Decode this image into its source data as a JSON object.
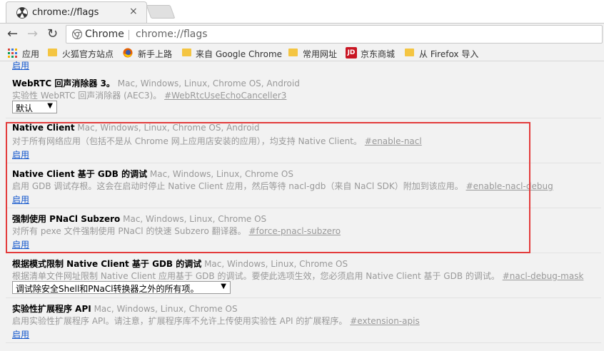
{
  "tab": {
    "title": "chrome://flags",
    "close": "×",
    "icon": "flags-radiation-icon"
  },
  "toolbar": {
    "back": "←",
    "forward": "→",
    "reload": "↻",
    "omni_chip": "Chrome",
    "url": "chrome://flags"
  },
  "bookmarks": [
    {
      "label": "应用"
    },
    {
      "label": "火狐官方站点"
    },
    {
      "label": "新手上路"
    },
    {
      "label": "来自 Google Chrome"
    },
    {
      "label": "常用网址"
    },
    {
      "label": "京东商城"
    },
    {
      "label": "从 Firefox 导入"
    }
  ],
  "top_link": "启用",
  "experiments": [
    {
      "name": "WebRTC 回声消除器 3。",
      "platforms": "Mac, Windows, Linux, Chrome OS, Android",
      "desc": "实验性 WebRTC 回声消除器 (AEC3)。",
      "anchor": "#WebRtcUseEchoCanceller3",
      "select": "默认"
    },
    {
      "name": "Native Client",
      "platforms": "Mac, Windows, Linux, Chrome OS, Android",
      "desc": "对于所有网络应用（包括不是从 Chrome 网上应用店安装的应用），均支持 Native Client。",
      "anchor": "#enable-nacl",
      "action": "启用"
    },
    {
      "name": "Native Client 基于 GDB 的调试",
      "platforms": "Mac, Windows, Linux, Chrome OS",
      "desc": "启用 GDB 调试存根。这会在启动时停止 Native Client 应用，然后等待 nacl-gdb（来自 NaCl SDK）附加到该应用。",
      "anchor": "#enable-nacl-debug",
      "action": "启用"
    },
    {
      "name": "强制使用 PNaCl Subzero",
      "platforms": "Mac, Windows, Linux, Chrome OS",
      "desc": "对所有 pexe 文件强制使用 PNaCl 的快速 Subzero 翻译器。",
      "anchor": "#force-pnacl-subzero",
      "action": "启用"
    },
    {
      "name": "根据模式限制 Native Client 基于 GDB 的调试",
      "platforms": "Mac, Windows, Linux, Chrome OS",
      "desc": "根据清单文件网址限制 Native Client 应用基于 GDB 的调试。要使此选项生效，您必须启用 Native Client 基于 GDB 的调试。",
      "anchor": "#nacl-debug-mask",
      "select": "调试除安全Shell和PNaCl转换器之外的所有项。"
    },
    {
      "name": "实验性扩展程序 API",
      "platforms": "Mac, Windows, Linux, Chrome OS",
      "desc": "启用实验性扩展程序 API。请注意，扩展程序库不允许上传使用实验性 API 的扩展程序。",
      "anchor": "#extension-apis",
      "action": "启用"
    }
  ],
  "colors": {
    "highlight": "#e33b3b",
    "link": "#1155cc"
  }
}
